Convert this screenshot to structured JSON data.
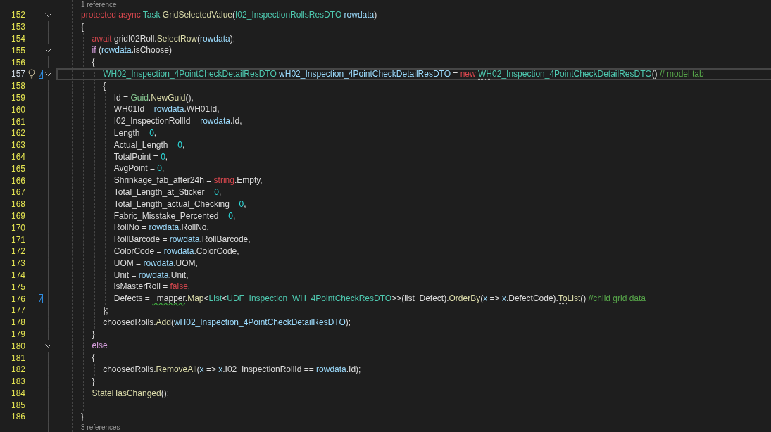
{
  "editor": {
    "lines": [
      {
        "kind": "codelens",
        "text": "1 reference"
      },
      {
        "kind": "code",
        "number": "152",
        "current": false,
        "expanded": true,
        "tokens": [
          {
            "kind": "keyword",
            "text": "protected async "
          },
          {
            "kind": "type",
            "text": "Task "
          },
          {
            "kind": "method",
            "text": "GridSelectedValue"
          },
          {
            "kind": "plain",
            "text": "("
          },
          {
            "kind": "type",
            "text": "I02_InspectionRollsResDTO "
          },
          {
            "kind": "variable",
            "text": "rowdata"
          },
          {
            "kind": "plain",
            "text": ")"
          }
        ]
      },
      {
        "kind": "code",
        "number": "153",
        "current": false,
        "tokens": [
          {
            "kind": "plain",
            "text": "{"
          }
        ],
        "children": [
          {
            "kind": "code",
            "number": "154",
            "current": false,
            "tokens": [
              {
                "kind": "keyword",
                "text": "await "
              },
              {
                "kind": "plain",
                "text": "gridI02Roll."
              },
              {
                "kind": "method",
                "text": "SelectRow"
              },
              {
                "kind": "plain",
                "text": "("
              },
              {
                "kind": "variable",
                "text": "rowdata"
              },
              {
                "kind": "plain",
                "text": ");"
              }
            ]
          },
          {
            "kind": "code",
            "number": "155",
            "current": false,
            "expanded": true,
            "tokens": [
              {
                "kind": "control",
                "text": "if"
              },
              {
                "kind": "plain",
                "text": " ("
              },
              {
                "kind": "variable",
                "text": "rowdata"
              },
              {
                "kind": "plain",
                "text": ".isChoose)"
              }
            ]
          },
          {
            "kind": "code",
            "number": "156",
            "current": false,
            "tokens": [
              {
                "kind": "plain",
                "text": "{"
              }
            ],
            "children": [
              {
                "kind": "code",
                "number": "157",
                "current": true,
                "expanded": true,
                "lightbulb": true,
                "edited": true,
                "tokens": [
                  {
                    "kind": "type",
                    "text": "WH02_Inspection_4PointCheckDetailResDTO "
                  },
                  {
                    "kind": "variable",
                    "text": "wH02_Inspection_4PointCheckDetailResDTO"
                  },
                  {
                    "kind": "plain",
                    "text": " = "
                  },
                  {
                    "kind": "keyword",
                    "text": "new "
                  },
                  {
                    "kind": "type",
                    "text": "WH",
                    "suggestion": true
                  },
                  {
                    "kind": "type",
                    "text": "02_Inspection_4PointCheckDetailResDTO"
                  },
                  {
                    "kind": "plain",
                    "text": "() "
                  },
                  {
                    "kind": "comment",
                    "text": "// model tab"
                  }
                ]
              },
              {
                "kind": "code",
                "number": "158",
                "current": false,
                "tokens": [
                  {
                    "kind": "plain",
                    "text": "{"
                  }
                ],
                "children": [
                  {
                    "kind": "code",
                    "number": "159",
                    "current": false,
                    "tokens": [
                      {
                        "kind": "plain",
                        "text": "Id = "
                      },
                      {
                        "kind": "struct",
                        "text": "Guid"
                      },
                      {
                        "kind": "plain",
                        "text": "."
                      },
                      {
                        "kind": "method",
                        "text": "NewGuid"
                      },
                      {
                        "kind": "plain",
                        "text": "(),"
                      }
                    ]
                  },
                  {
                    "kind": "code",
                    "number": "160",
                    "current": false,
                    "tokens": [
                      {
                        "kind": "plain",
                        "text": "WH01Id = "
                      },
                      {
                        "kind": "variable",
                        "text": "rowdata"
                      },
                      {
                        "kind": "plain",
                        "text": ".WH01Id,"
                      }
                    ]
                  },
                  {
                    "kind": "code",
                    "number": "161",
                    "current": false,
                    "tokens": [
                      {
                        "kind": "plain",
                        "text": "I02_InspectionRollId = "
                      },
                      {
                        "kind": "variable",
                        "text": "rowdata"
                      },
                      {
                        "kind": "plain",
                        "text": ".Id,"
                      }
                    ]
                  },
                  {
                    "kind": "code",
                    "number": "162",
                    "current": false,
                    "tokens": [
                      {
                        "kind": "plain",
                        "text": "Length = "
                      },
                      {
                        "kind": "number",
                        "text": "0"
                      },
                      {
                        "kind": "plain",
                        "text": ","
                      }
                    ]
                  },
                  {
                    "kind": "code",
                    "number": "163",
                    "current": false,
                    "tokens": [
                      {
                        "kind": "plain",
                        "text": "Actual_Length = "
                      },
                      {
                        "kind": "number",
                        "text": "0"
                      },
                      {
                        "kind": "plain",
                        "text": ","
                      }
                    ]
                  },
                  {
                    "kind": "code",
                    "number": "164",
                    "current": false,
                    "tokens": [
                      {
                        "kind": "plain",
                        "text": "TotalPoint = "
                      },
                      {
                        "kind": "number",
                        "text": "0"
                      },
                      {
                        "kind": "plain",
                        "text": ","
                      }
                    ]
                  },
                  {
                    "kind": "code",
                    "number": "165",
                    "current": false,
                    "tokens": [
                      {
                        "kind": "plain",
                        "text": "AvgPoint = "
                      },
                      {
                        "kind": "number",
                        "text": "0"
                      },
                      {
                        "kind": "plain",
                        "text": ","
                      }
                    ]
                  },
                  {
                    "kind": "code",
                    "number": "166",
                    "current": false,
                    "tokens": [
                      {
                        "kind": "plain",
                        "text": "Shrinkage_fab_after24h = "
                      },
                      {
                        "kind": "keyword",
                        "text": "string"
                      },
                      {
                        "kind": "plain",
                        "text": ".Empty,"
                      }
                    ]
                  },
                  {
                    "kind": "code",
                    "number": "167",
                    "current": false,
                    "tokens": [
                      {
                        "kind": "plain",
                        "text": "Total_Length_at_Sticker = "
                      },
                      {
                        "kind": "number",
                        "text": "0"
                      },
                      {
                        "kind": "plain",
                        "text": ","
                      }
                    ]
                  },
                  {
                    "kind": "code",
                    "number": "168",
                    "current": false,
                    "tokens": [
                      {
                        "kind": "plain",
                        "text": "Total_Length_actual_Checking = "
                      },
                      {
                        "kind": "number",
                        "text": "0"
                      },
                      {
                        "kind": "plain",
                        "text": ","
                      }
                    ]
                  },
                  {
                    "kind": "code",
                    "number": "169",
                    "current": false,
                    "tokens": [
                      {
                        "kind": "plain",
                        "text": "Fabric_Misstake_Percented = "
                      },
                      {
                        "kind": "number",
                        "text": "0"
                      },
                      {
                        "kind": "plain",
                        "text": ","
                      }
                    ]
                  },
                  {
                    "kind": "code",
                    "number": "170",
                    "current": false,
                    "tokens": [
                      {
                        "kind": "plain",
                        "text": "RollNo = "
                      },
                      {
                        "kind": "variable",
                        "text": "rowdata"
                      },
                      {
                        "kind": "plain",
                        "text": ".RollNo,"
                      }
                    ]
                  },
                  {
                    "kind": "code",
                    "number": "171",
                    "current": false,
                    "tokens": [
                      {
                        "kind": "plain",
                        "text": "RollBarcode = "
                      },
                      {
                        "kind": "variable",
                        "text": "rowdata"
                      },
                      {
                        "kind": "plain",
                        "text": ".RollBarcode,"
                      }
                    ]
                  },
                  {
                    "kind": "code",
                    "number": "172",
                    "current": false,
                    "tokens": [
                      {
                        "kind": "plain",
                        "text": "ColorCode = "
                      },
                      {
                        "kind": "variable",
                        "text": "rowdata"
                      },
                      {
                        "kind": "plain",
                        "text": ".ColorCode,"
                      }
                    ]
                  },
                  {
                    "kind": "code",
                    "number": "173",
                    "current": false,
                    "tokens": [
                      {
                        "kind": "plain",
                        "text": "UOM = "
                      },
                      {
                        "kind": "variable",
                        "text": "rowdata"
                      },
                      {
                        "kind": "plain",
                        "text": ".UOM,"
                      }
                    ]
                  },
                  {
                    "kind": "code",
                    "number": "174",
                    "current": false,
                    "tokens": [
                      {
                        "kind": "plain",
                        "text": "Unit = "
                      },
                      {
                        "kind": "variable",
                        "text": "rowdata"
                      },
                      {
                        "kind": "plain",
                        "text": ".Unit,"
                      }
                    ]
                  },
                  {
                    "kind": "code",
                    "number": "175",
                    "current": false,
                    "tokens": [
                      {
                        "kind": "plain",
                        "text": "isMasterRoll = "
                      },
                      {
                        "kind": "keyword",
                        "text": "false"
                      },
                      {
                        "kind": "plain",
                        "text": ","
                      }
                    ]
                  },
                  {
                    "kind": "code",
                    "number": "176",
                    "current": false,
                    "edited": true,
                    "tokens": [
                      {
                        "kind": "plain",
                        "text": "Defects = "
                      },
                      {
                        "kind": "plain",
                        "text": "_mapper",
                        "warning": true
                      },
                      {
                        "kind": "plain",
                        "text": "."
                      },
                      {
                        "kind": "method",
                        "text": "Map"
                      },
                      {
                        "kind": "plain",
                        "text": "<"
                      },
                      {
                        "kind": "type",
                        "text": "List"
                      },
                      {
                        "kind": "plain",
                        "text": "<"
                      },
                      {
                        "kind": "type",
                        "text": "UDF_Inspection_WH_4PointCheckResDTO"
                      },
                      {
                        "kind": "plain",
                        "text": ">>(list_Defect)."
                      },
                      {
                        "kind": "method",
                        "text": "OrderBy"
                      },
                      {
                        "kind": "plain",
                        "text": "("
                      },
                      {
                        "kind": "variable",
                        "text": "x"
                      },
                      {
                        "kind": "plain",
                        "text": " => "
                      },
                      {
                        "kind": "variable",
                        "text": "x"
                      },
                      {
                        "kind": "plain",
                        "text": ".DefectCode)."
                      },
                      {
                        "kind": "method",
                        "text": "To",
                        "suggestion": true
                      },
                      {
                        "kind": "method",
                        "text": "List"
                      },
                      {
                        "kind": "plain",
                        "text": "() "
                      },
                      {
                        "kind": "comment",
                        "text": "//child grid data"
                      }
                    ]
                  }
                ]
              },
              {
                "kind": "code",
                "number": "177",
                "current": false,
                "tokens": [
                  {
                    "kind": "plain",
                    "text": "};"
                  }
                ]
              },
              {
                "kind": "code",
                "number": "178",
                "current": false,
                "tokens": [
                  {
                    "kind": "plain",
                    "text": "choosedRolls."
                  },
                  {
                    "kind": "method",
                    "text": "Add"
                  },
                  {
                    "kind": "plain",
                    "text": "("
                  },
                  {
                    "kind": "variable",
                    "text": "wH02_Inspection_4PointCheckDetailResDTO"
                  },
                  {
                    "kind": "plain",
                    "text": ");"
                  }
                ]
              }
            ]
          },
          {
            "kind": "code",
            "number": "179",
            "current": false,
            "tokens": [
              {
                "kind": "plain",
                "text": "}"
              }
            ]
          },
          {
            "kind": "code",
            "number": "180",
            "current": false,
            "expanded": true,
            "tokens": [
              {
                "kind": "control",
                "text": "else"
              }
            ]
          },
          {
            "kind": "code",
            "number": "181",
            "current": false,
            "tokens": [
              {
                "kind": "plain",
                "text": "{"
              }
            ],
            "children": [
              {
                "kind": "code",
                "number": "182",
                "current": false,
                "tokens": [
                  {
                    "kind": "plain",
                    "text": "choosedRolls."
                  },
                  {
                    "kind": "method",
                    "text": "RemoveAll"
                  },
                  {
                    "kind": "plain",
                    "text": "("
                  },
                  {
                    "kind": "variable",
                    "text": "x"
                  },
                  {
                    "kind": "plain",
                    "text": " => "
                  },
                  {
                    "kind": "variable",
                    "text": "x"
                  },
                  {
                    "kind": "plain",
                    "text": ".I02_InspectionRollId == "
                  },
                  {
                    "kind": "variable",
                    "text": "rowdata"
                  },
                  {
                    "kind": "plain",
                    "text": ".Id);"
                  }
                ]
              }
            ]
          },
          {
            "kind": "code",
            "number": "183",
            "current": false,
            "tokens": [
              {
                "kind": "plain",
                "text": "}"
              }
            ]
          },
          {
            "kind": "code",
            "number": "184",
            "current": false,
            "tokens": [
              {
                "kind": "method",
                "text": "StateHasChanged"
              },
              {
                "kind": "plain",
                "text": "();"
              }
            ]
          },
          {
            "kind": "code",
            "number": "185",
            "current": false
          }
        ]
      },
      {
        "kind": "code",
        "number": "186",
        "current": false,
        "tokens": [
          {
            "kind": "plain",
            "text": "}"
          }
        ]
      },
      {
        "kind": "codelens",
        "text": "3 references"
      }
    ]
  }
}
